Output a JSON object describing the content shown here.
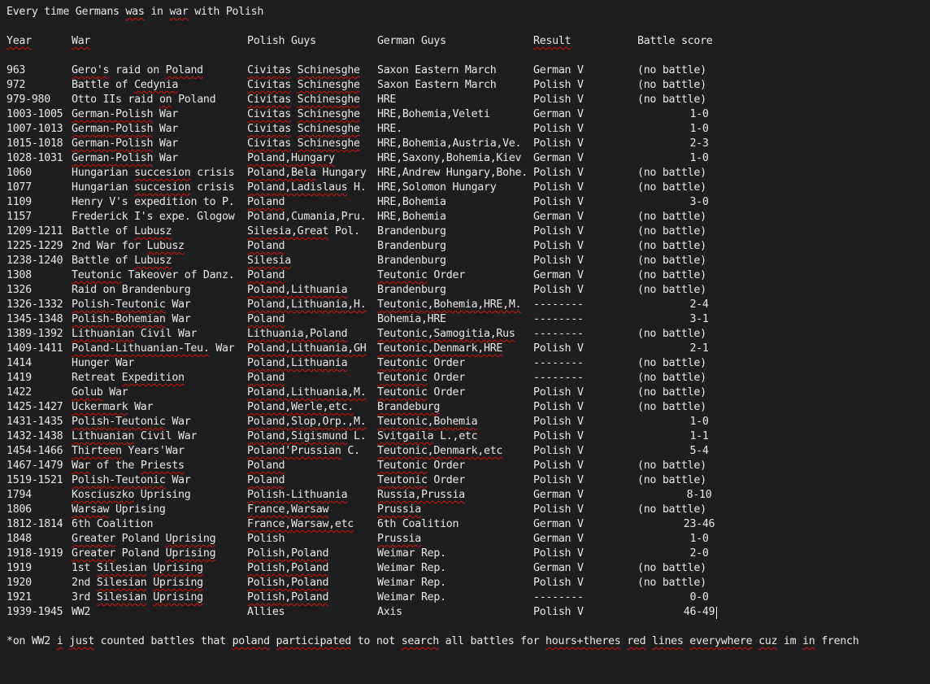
{
  "title": "Every time Germans was in war with Polish",
  "headers": [
    "Year",
    "War",
    "Polish Guys",
    "German Guys",
    "Result",
    "Battle score"
  ],
  "rows": [
    [
      "963",
      "Gero's raid on Poland",
      "Civitas Schinesghe",
      "Saxon Eastern March",
      "German V",
      "(no battle)"
    ],
    [
      "972",
      "Battle of Cedynia",
      "Civitas Schinesghe",
      "Saxon Eastern March",
      "Polish V",
      "(no battle)"
    ],
    [
      "979-980",
      "Otto IIs raid on Poland",
      "Civitas Schinesghe",
      "HRE",
      "Polish V",
      "(no battle)"
    ],
    [
      "1003-1005",
      "German-Polish War",
      "Civitas Schinesghe",
      "HRE,Bohemia,Veleti",
      "German V",
      "1-0"
    ],
    [
      "1007-1013",
      "German-Polish War",
      "Civitas Schinesghe",
      "HRE.",
      "Polish V",
      "1-0"
    ],
    [
      "1015-1018",
      "German-Polish War",
      "Civitas Schinesghe",
      "HRE,Bohemia,Austria,Ve.",
      "Polish V",
      "2-3"
    ],
    [
      "1028-1031",
      "German-Polish War",
      "Poland,Hungary",
      "HRE,Saxony,Bohemia,Kiev",
      "German V",
      "1-0"
    ],
    [
      "1060",
      "Hungarian succesion crisis",
      "Poland,Bela Hungary",
      "HRE,Andrew Hungary,Bohe.",
      "Polish V",
      "(no battle)"
    ],
    [
      "1077",
      "Hungarian succesion crisis",
      "Poland,Ladislaus H.",
      "HRE,Solomon Hungary",
      "Polish V",
      "(no battle)"
    ],
    [
      "1109",
      "Henry V's expedition to P.",
      "Poland",
      "HRE,Bohemia",
      "Polish V",
      "3-0"
    ],
    [
      "1157",
      "Frederick I's expe. Glogow",
      "Poland,Cumania,Pru.",
      "HRE,Bohemia",
      "German V",
      "(no battle)"
    ],
    [
      "1209-1211",
      "Battle of Lubusz",
      "Silesia,Great Pol.",
      "Brandenburg",
      "Polish V",
      "(no battle)"
    ],
    [
      "1225-1229",
      "2nd War for Lubusz",
      "Poland",
      "Brandenburg",
      "Polish V",
      "(no battle)"
    ],
    [
      "1238-1240",
      "Battle of Lubusz",
      "Silesia",
      "Brandenburg",
      "Polish V",
      "(no battle)"
    ],
    [
      "1308",
      "Teutonic Takeover of Danz.",
      "Poland",
      "Teutonic Order",
      "German V",
      "(no battle)"
    ],
    [
      "1326",
      "Raid on Brandenburg",
      "Poland,Lithuania",
      "Brandenburg",
      "Polish V",
      "(no battle)"
    ],
    [
      "1326-1332",
      "Polish-Teutonic War",
      "Poland,Lithuania,H.",
      "Teutonic,Bohemia,HRE,M.",
      "--------",
      "2-4"
    ],
    [
      "1345-1348",
      "Polish-Bohemian War",
      "Poland",
      "Bohemia,HRE",
      "--------",
      "3-1"
    ],
    [
      "1389-1392",
      "Lithuanian Civil War",
      "Lithuania,Poland",
      "Teutonic,Samogitia,Rus",
      "--------",
      "(no battle)"
    ],
    [
      "1409-1411",
      "Poland-Lithuanian-Teu. War",
      "Poland,Lithuania,GH",
      "Teutonic,Denmark,HRE",
      "Polish V",
      "2-1"
    ],
    [
      "1414",
      "Hunger War",
      "Poland,Lithuania",
      "Teutonic Order",
      "--------",
      "(no battle)"
    ],
    [
      "1419",
      "Retreat Expedition",
      "Poland",
      "Teutonic Order",
      "--------",
      "(no battle)"
    ],
    [
      "1422",
      "Golub War",
      "Poland,Lithuania,M.",
      "Teutonic Order",
      "Polish V",
      "(no battle)"
    ],
    [
      "1425-1427",
      "Uckermark War",
      "Poland,Werle,etc.",
      "Brandeburg",
      "Polish V",
      "(no battle)"
    ],
    [
      "1431-1435",
      "Polish-Teutonic War",
      "Poland,Slop,Orp.,M.",
      "Teutonic,Bohemia",
      "Polish V",
      "1-0"
    ],
    [
      "1432-1438",
      "Lithuanian Civil War",
      "Poland,Sigismund L.",
      "Svitgaila L.,etc",
      "Polish V",
      "1-1"
    ],
    [
      "1454-1466",
      "Thirteen Years'War",
      "Poland'Prussian C.",
      "Teutonic,Denmark,etc",
      "Polish V",
      "5-4"
    ],
    [
      "1467-1479",
      "War of the Priests",
      "Poland",
      "Teutonic Order",
      "Polish V",
      "(no battle)"
    ],
    [
      "1519-1521",
      "Polish-Teutonic War",
      "Poland",
      "Teutonic Order",
      "Polish V",
      "(no battle)"
    ],
    [
      "1794",
      "Kosciuszko Uprising",
      "Polish-Lithuania",
      "Russia,Prussia",
      "German V",
      "8-10"
    ],
    [
      "1806",
      "Warsaw Uprising",
      "France,Warsaw",
      "Prussia",
      "Polish V",
      "(no battle)"
    ],
    [
      "1812-1814",
      "6th Coalition",
      "France,Warsaw,etc",
      "6th Coalition",
      "German V",
      "23-46"
    ],
    [
      "1848",
      "Greater Poland Uprising",
      "Polish",
      "Prussia",
      "German V",
      "1-0"
    ],
    [
      "1918-1919",
      "Greater Poland Uprising",
      "Polish,Poland",
      "Weimar Rep.",
      "Polish V",
      "2-0"
    ],
    [
      "1919",
      "1st Silesian Uprising",
      "Polish,Poland",
      "Weimar Rep.",
      "German V",
      "(no battle)"
    ],
    [
      "1920",
      "2nd Silesian Uprising",
      "Polish,Poland",
      "Weimar Rep.",
      "Polish V",
      "(no battle)"
    ],
    [
      "1921",
      "3rd Silesian Uprising",
      "Polish,Poland",
      "Weimar Rep.",
      "--------",
      "0-0"
    ],
    [
      "1939-1945",
      "WW2",
      "Allies",
      "Axis",
      "Polish V",
      "46-49"
    ]
  ],
  "footnote": "*on WW2 i just counted battles that poland participated to not search all battles for hours+theres red lines everywhere cuz im in french",
  "colors": {
    "background": "#1e1e1e",
    "text": "#e8e8e8",
    "spellcheck": "#d01010"
  }
}
